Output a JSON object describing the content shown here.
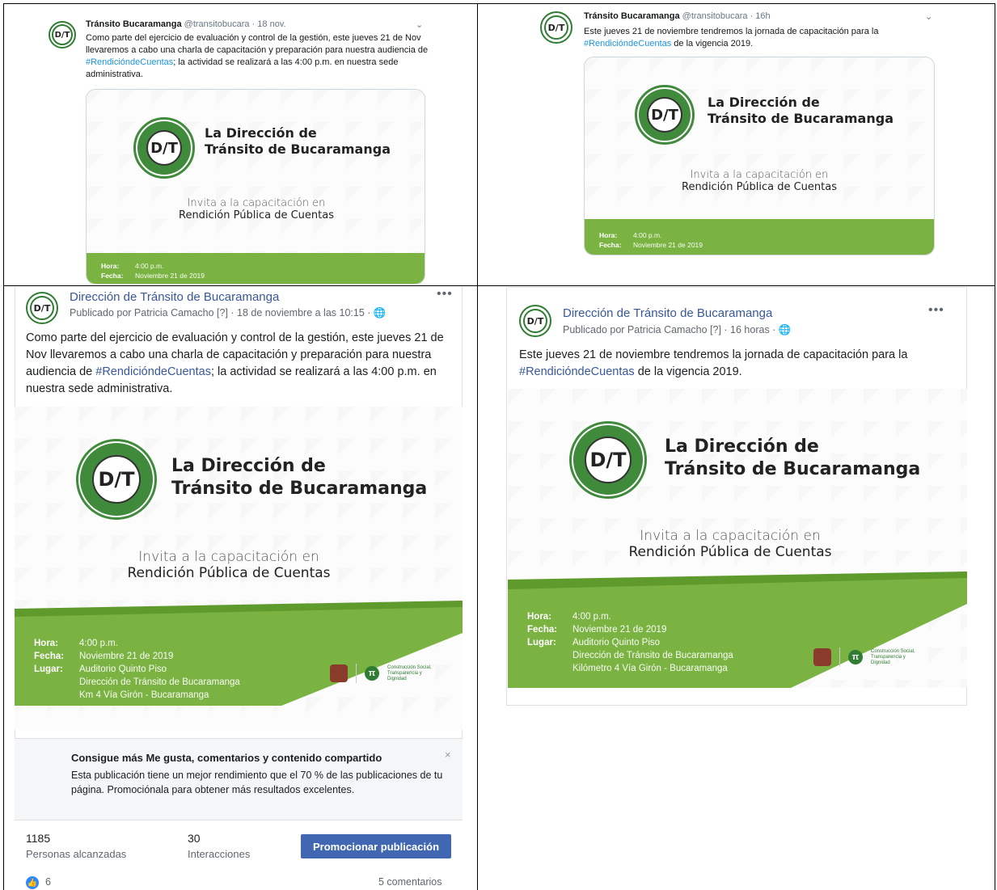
{
  "tweet1": {
    "name": "Tránsito Bucaramanga",
    "meta": "@transitobucara · 18 nov.",
    "body_pre": "Como parte del ejercicio de evaluación y control de la gestión, este jueves 21 de Nov llevaremos a cabo una charla de capacitación y preparación para nuestra audiencia de ",
    "hashtag": "#RendicióndeCuentas",
    "body_post": "; la actividad se realizará a las 4:00 p.m. en nuestra sede administrativa."
  },
  "tweet2": {
    "name": "Tránsito Bucaramanga",
    "meta": "@transitobucara · 16h",
    "body_pre": "Este jueves 21 de noviembre tendremos la jornada de capacitación para la ",
    "hashtag": "#RendicióndeCuentas",
    "body_post": " de la vigencia 2019."
  },
  "fb1": {
    "page_name": "Dirección de Tránsito de Bucaramanga",
    "sub": "Publicado por Patricia Camacho [?] · 18 de noviembre a las 10:15 · ",
    "body_pre": "Como parte del ejercicio de evaluación y control de la gestión, este jueves 21 de Nov llevaremos a cabo una charla de capacitación y preparación para nuestra audiencia de ",
    "hashtag": "#RendicióndeCuentas",
    "body_post": "; la actividad se realizará a las 4:00 p.m. en nuestra sede administrativa.",
    "promo_title": "Consigue más Me gusta, comentarios y contenido compartido",
    "promo_text": "Esta publicación tiene un mejor rendimiento que el 70 % de las publicaciones de tu página. Promociónala para obtener más resultados excelentes.",
    "reach_value": "1185",
    "reach_label": "Personas alcanzadas",
    "interactions_value": "30",
    "interactions_label": "Interacciones",
    "promote_button": "Promocionar publicación",
    "likes": "6",
    "comments": "5 comentarios"
  },
  "fb2": {
    "page_name": "Dirección de Tránsito de Bucaramanga",
    "sub": "Publicado por Patricia Camacho [?] · 16 horas · ",
    "body_pre": "Este jueves 21 de noviembre tendremos la jornada de capacitación para la ",
    "hashtag": "#RendicióndeCuentas",
    "body_post": " de la vigencia 2019."
  },
  "card": {
    "logo_letters_top": "D",
    "logo_letters_bottom": "T",
    "logo_ring_text": "DIRECCIÓN DE TRÁNSITO · BUCARAMANGA",
    "title_line1": "La Dirección de",
    "title_line2": "Tránsito de Bucaramanga",
    "invite_line1": "Invita a la capacitación en",
    "invite_line2": "Rendición Pública de Cuentas",
    "hora_label": "Hora:",
    "hora_value": "4:00 p.m.",
    "fecha_label": "Fecha:",
    "fecha_value": "Noviembre 21 de 2019",
    "lugar_label": "Lugar:",
    "lugar_value1": "Auditorio Quinto Piso",
    "lugar_value2": "Dirección de Tránsito de Bucaramanga",
    "lugar_value3_fb1": "Km 4 Vía Girón - Bucaramanga",
    "lugar_value3_fb2": "Kilómetro 4 Vía Girón - Bucaramanga",
    "partner_text": "Construcción Social, Transparencia y Dignidad"
  },
  "colors": {
    "brand_green": "#7bb342",
    "fb_link": "#385898",
    "tw_link": "#1b95e0",
    "fb_button": "#4267b2"
  }
}
